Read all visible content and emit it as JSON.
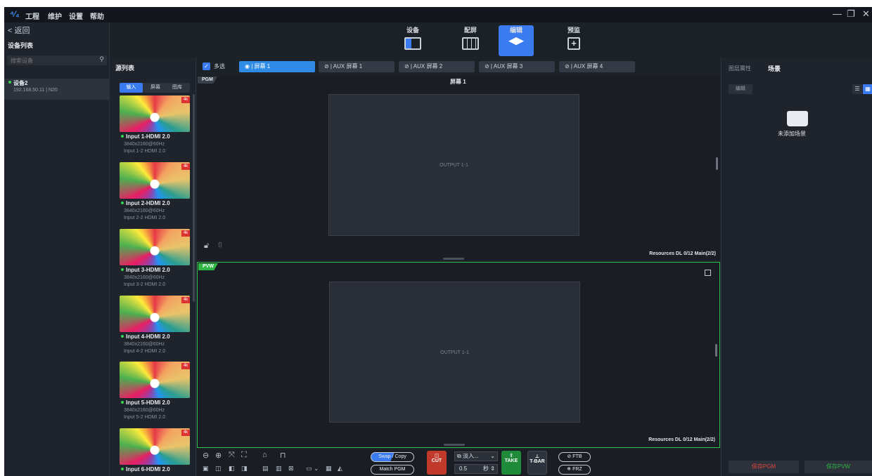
{
  "menu": {
    "logo": "⁴⁄₄",
    "items": [
      "工程",
      "维护",
      "设置",
      "帮助"
    ]
  },
  "window": {
    "minimize": "—",
    "restore": "❐",
    "close": "✕"
  },
  "left": {
    "back": "< 返回",
    "title": "设备列表",
    "search_placeholder": "搜索设备",
    "device_name": "设备2",
    "device_info": "192.168.50.11 | N20"
  },
  "modes": [
    {
      "label": "设备"
    },
    {
      "label": "配屏"
    },
    {
      "label": "编辑"
    },
    {
      "label": "预监"
    }
  ],
  "source": {
    "title": "源列表",
    "tabs": [
      "输入",
      "屏幕",
      "图库"
    ],
    "cards": [
      {
        "name": "Input 1-HDMI 2.0",
        "res": "3840x2160@60Hz",
        "sub": "Input 1-2  HDMI 2.0"
      },
      {
        "name": "Input 2-HDMI 2.0",
        "res": "3840x2160@60Hz",
        "sub": "Input 2-2  HDMI 2.0"
      },
      {
        "name": "Input 3-HDMI 2.0",
        "res": "3840x2160@60Hz",
        "sub": "Input 3-2  HDMI 2.0"
      },
      {
        "name": "Input 4-HDMI 2.0",
        "res": "3840x2160@60Hz",
        "sub": "Input 4-2  HDMI 2.0"
      },
      {
        "name": "Input 5-HDMI 2.0",
        "res": "3840x2160@60Hz",
        "sub": "Input 5-2  HDMI 2.0"
      },
      {
        "name": "Input 6-HDMI 2.0",
        "res": "",
        "sub": ""
      }
    ],
    "badge": "4k"
  },
  "tabs": {
    "multi": "多选",
    "screens": [
      "屏幕 1",
      "AUX 屏幕 1",
      "AUX 屏幕 2",
      "AUX 屏幕 3",
      "AUX 屏幕 4"
    ]
  },
  "pgm": {
    "tag": "PGM",
    "title": "屏幕 1",
    "output": "OUTPUT 1-1",
    "resources": "Resources DL  0/12 Main(2/2)"
  },
  "pvw": {
    "tag": "PVW",
    "output": "OUTPUT 1-1",
    "resources": "Resources DL  0/12 Main(2/2)"
  },
  "controls": {
    "swap": "Swap",
    "copy": "Copy",
    "match": "Match PGM",
    "cut": "CUT",
    "effect": "淡入...",
    "duration": "0.5",
    "unit": "秒",
    "take": "TAKE",
    "tbar": "T-BAR",
    "ftb": "FTB",
    "frz": "FRZ"
  },
  "right": {
    "tabs": [
      "图层属性",
      "场景"
    ],
    "edit": "编辑",
    "empty": "未添加场景",
    "save_pgm": "保存PGM",
    "save_pvw": "保存PVW"
  }
}
